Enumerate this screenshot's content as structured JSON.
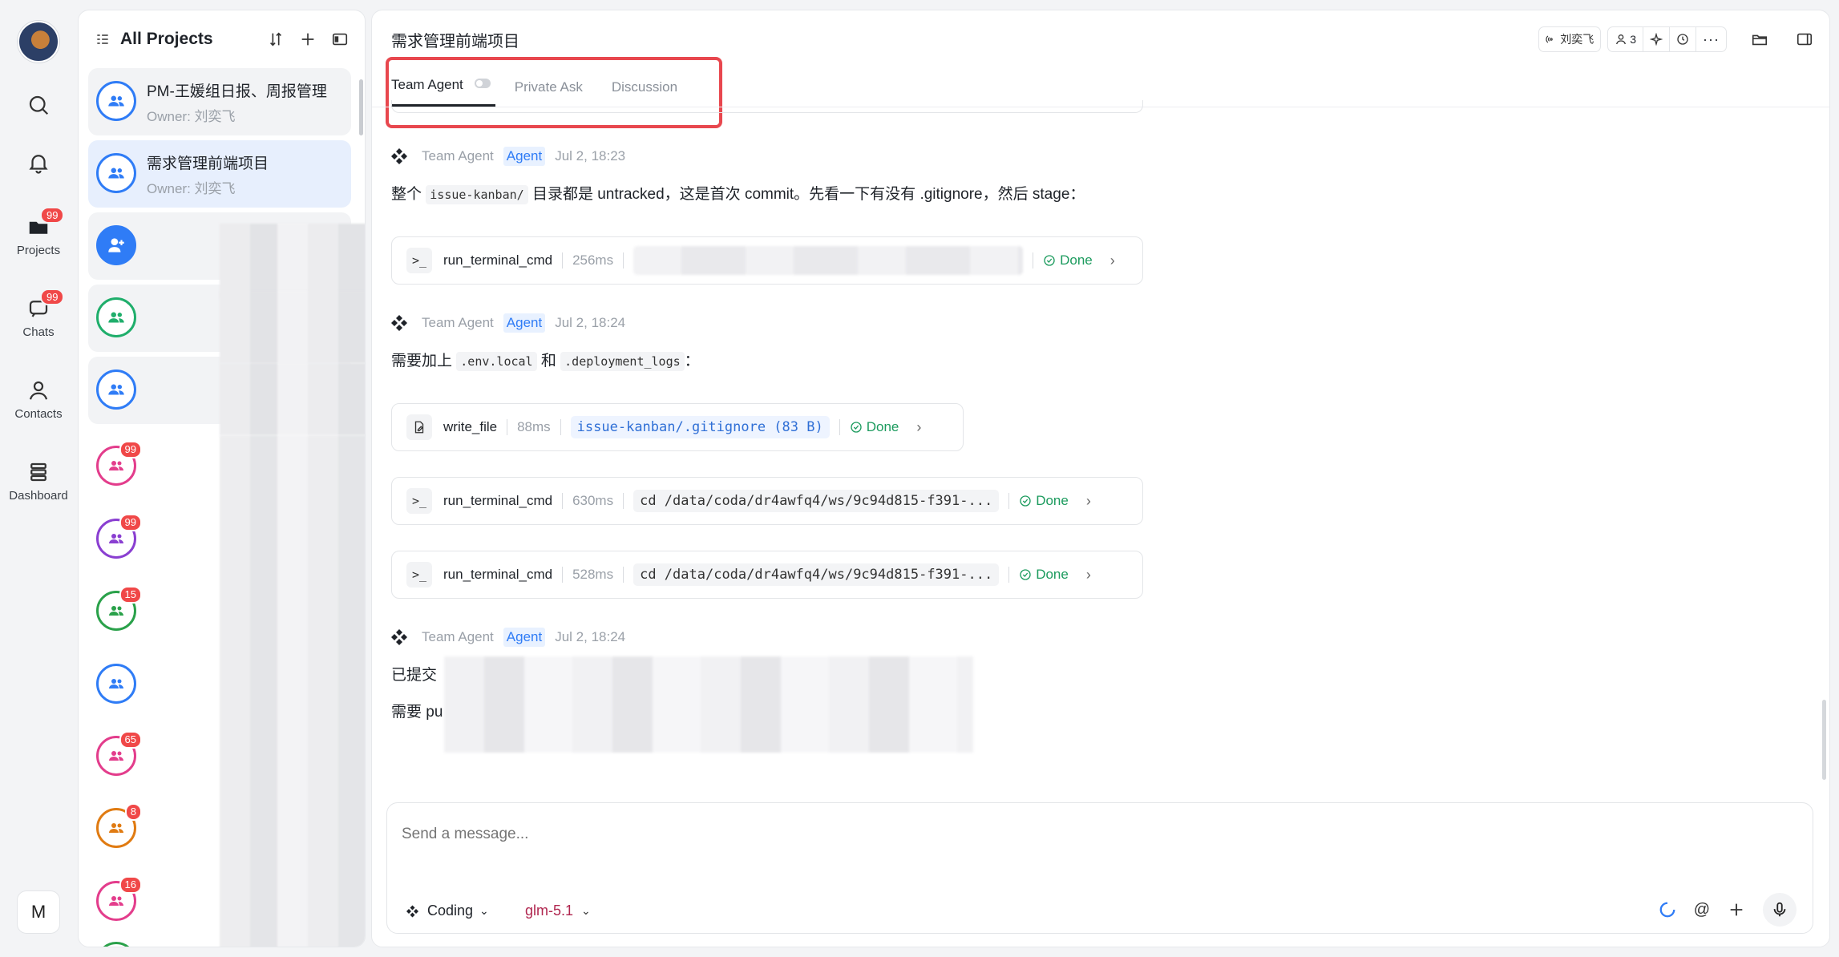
{
  "rail": {
    "items": [
      {
        "name": "search",
        "label": ""
      },
      {
        "name": "notifications",
        "label": ""
      },
      {
        "name": "projects",
        "label": "Projects",
        "badge": "99"
      },
      {
        "name": "chats",
        "label": "Chats",
        "badge": "99"
      },
      {
        "name": "contacts",
        "label": "Contacts"
      },
      {
        "name": "dashboard",
        "label": "Dashboard"
      }
    ],
    "bottom_letter": "M"
  },
  "project_list": {
    "title": "All Projects",
    "items": [
      {
        "title": "PM-王媛组日报、周报管理",
        "owner": "Owner: 刘奕飞",
        "active": false
      },
      {
        "title": "需求管理前端项目",
        "owner": "Owner: 刘奕飞",
        "active": true
      }
    ],
    "badges": [
      "99",
      "99",
      "15",
      "65",
      "8",
      "16"
    ]
  },
  "chat": {
    "title": "需求管理前端项目",
    "header": {
      "user_label": "刘奕飞",
      "member_count": "3"
    },
    "tabs": [
      "Team Agent",
      "Private Ask",
      "Discussion"
    ],
    "messages": [
      {
        "sender": "Team Agent",
        "tag": "Agent",
        "time": "Jul 2, 18:23",
        "text_pre": "整个 ",
        "code": "issue-kanban/",
        "text_post": " 目录都是 untracked，这是首次 commit。先看一下有没有 .gitignore，然后 stage："
      },
      {
        "sender": "Team Agent",
        "tag": "Agent",
        "time": "Jul 2, 18:24",
        "text_pre": "需要加上 ",
        "code1": ".env.local",
        "text_mid": " 和 ",
        "code2": ".deployment_logs",
        "text_post": "："
      },
      {
        "sender": "Team Agent",
        "tag": "Agent",
        "time": "Jul 2, 18:24",
        "line1": "已提交",
        "line2": "需要 pu"
      }
    ],
    "tools": [
      {
        "name": "run_terminal_cmd",
        "ms": "256ms",
        "arg": "",
        "status": "Done"
      },
      {
        "name": "write_file",
        "ms": "88ms",
        "arg": "issue-kanban/.gitignore (83 B)",
        "status": "Done"
      },
      {
        "name": "run_terminal_cmd",
        "ms": "630ms",
        "arg": "cd /data/coda/dr4awfq4/ws/9c94d815-f391-...",
        "status": "Done"
      },
      {
        "name": "run_terminal_cmd",
        "ms": "528ms",
        "arg": "cd /data/coda/dr4awfq4/ws/9c94d815-f391-...",
        "status": "Done"
      }
    ]
  },
  "composer": {
    "placeholder": "Send a message...",
    "mode": "Coding",
    "model": "glm-5.1"
  },
  "colors": {
    "accent": "#2f7cf6",
    "done": "#1c9b5e",
    "highlight": "#e8474e",
    "badge": "#f04848",
    "model": "#b0264f"
  }
}
